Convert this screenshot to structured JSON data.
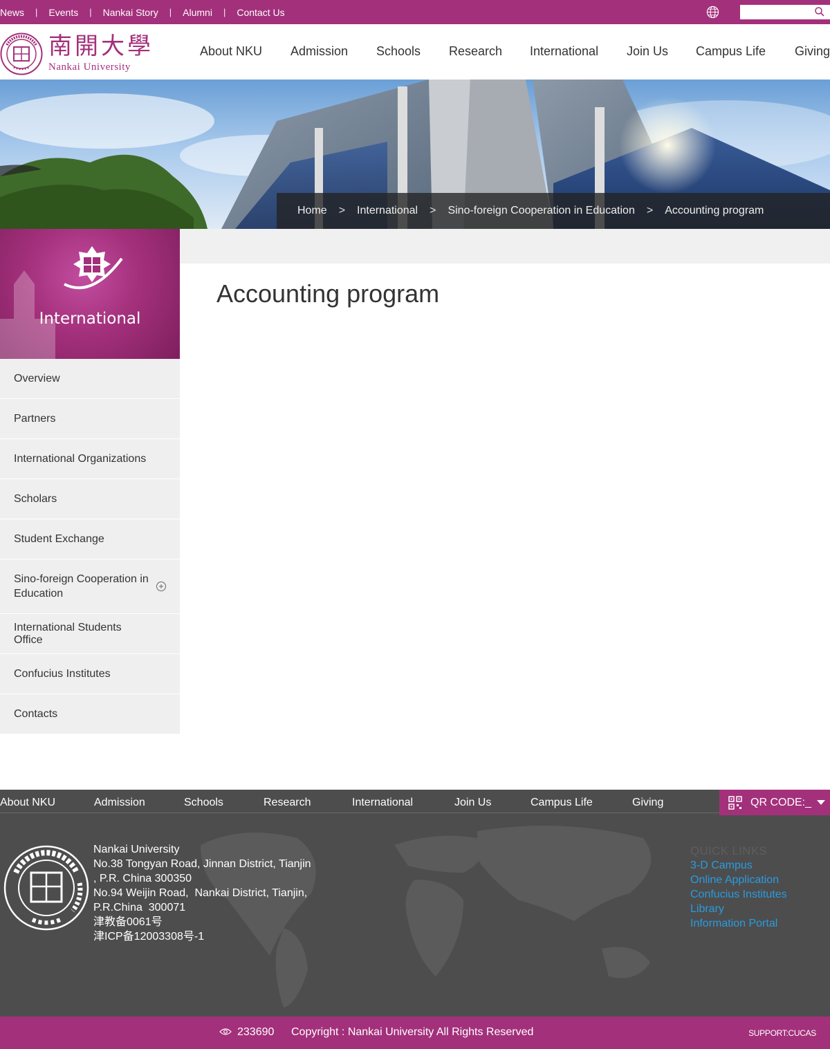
{
  "topbar": {
    "links": [
      "News",
      "Events",
      "Nankai Story",
      "Alumni",
      "Contact Us"
    ],
    "search_placeholder": ""
  },
  "header": {
    "logo_cn": "南開大學",
    "logo_en": "Nankai University",
    "nav": [
      "About NKU",
      "Admission",
      "Schools",
      "Research",
      "International",
      "Join Us",
      "Campus Life",
      "Giving"
    ]
  },
  "breadcrumb": {
    "items": [
      "Home",
      "International",
      "Sino-foreign Cooperation in Education",
      "Accounting program"
    ],
    "separator": ">"
  },
  "sidebar": {
    "title": "International",
    "items": [
      {
        "label": "Overview"
      },
      {
        "label": "Partners"
      },
      {
        "label": "International Organizations"
      },
      {
        "label": "Scholars"
      },
      {
        "label": "Student Exchange"
      },
      {
        "label": "Sino-foreign Cooperation in Education",
        "expandable": true
      },
      {
        "label": "International Students Office"
      },
      {
        "label": "Confucius Institutes"
      },
      {
        "label": "Contacts"
      }
    ]
  },
  "content": {
    "title": "Accounting program"
  },
  "footer": {
    "nav": [
      "About NKU",
      "Admission",
      "Schools",
      "Research",
      "International",
      "Join Us",
      "Campus Life",
      "Giving"
    ],
    "qr_label": "QR CODE:_",
    "address_lines": [
      "Nankai University",
      "No.38 Tongyan Road, Jinnan District, Tianjin",
      ", P.R. China 300350",
      "No.94 Weijin Road,  Nankai District, Tianjin,",
      "P.R.China  300071",
      "津教备0061号",
      "津ICP备12003308号-1"
    ],
    "quick_links_heading": "QUICK LINKS",
    "quick_links": [
      "3-D Campus",
      "Online Application",
      "Confucius Institutes",
      "Library",
      "Information Portal"
    ]
  },
  "bottombar": {
    "visit_count": "233690",
    "copyright": "Copyright : Nankai University All Rights Reserved",
    "support": "SUPPORT:CUCAS"
  },
  "colors": {
    "brand": "#a3307b",
    "footer_bg": "#4d4d4d",
    "link": "#2a9be0",
    "sidebar_bg": "#efefef"
  },
  "icons": [
    "globe-icon",
    "search-icon",
    "university-seal-logo",
    "plus-circle-icon",
    "qr-code-icon",
    "chevron-down-icon",
    "eye-icon"
  ]
}
